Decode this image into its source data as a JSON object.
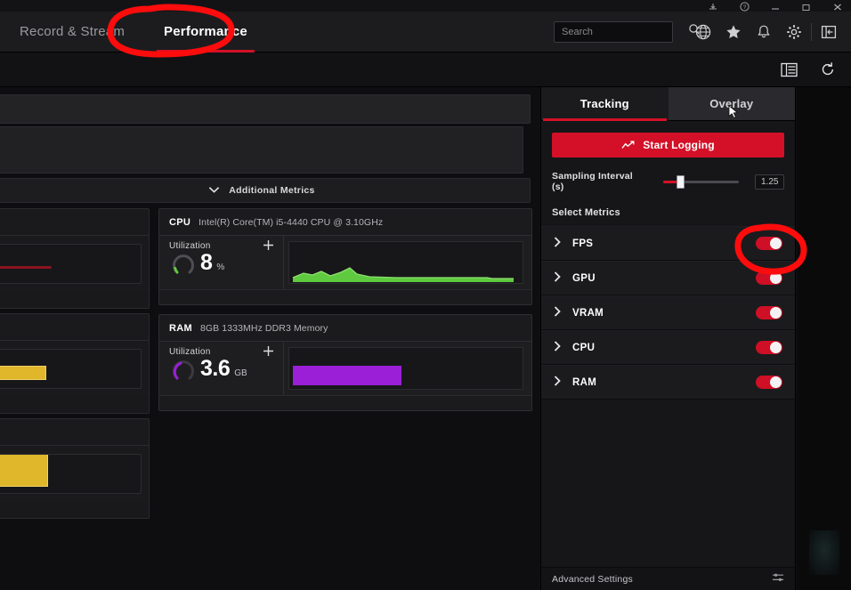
{
  "window": {
    "controls": [
      "minimize-to-tray-icon",
      "help-icon",
      "minimize-icon",
      "restore-icon",
      "close-icon"
    ]
  },
  "nav": {
    "tabs": [
      {
        "label": "Record & Stream",
        "active": false
      },
      {
        "label": "Performance",
        "active": true
      }
    ],
    "search": {
      "placeholder": "Search",
      "value": ""
    },
    "icons": [
      "globe-icon",
      "star-icon",
      "bell-icon",
      "gear-icon",
      "panel-toggle-icon"
    ]
  },
  "subtoolbar": {
    "icons": [
      "list-view-icon",
      "reset-icon"
    ]
  },
  "main": {
    "additional_metrics": {
      "label": "Additional Metrics",
      "icon": "chevron-down-icon"
    },
    "cards": [
      {
        "tag": "CPU",
        "description": "Intel(R) Core(TM) i5-4440 CPU @ 3.10GHz",
        "metric_label": "Utilization",
        "value": "8",
        "unit": "%",
        "graph_color": "#5fc93f",
        "add_icon": "plus-icon"
      },
      {
        "tag": "RAM",
        "description": "8GB 1333MHz DDR3 Memory",
        "metric_label": "Utilization",
        "value": "3.6",
        "unit": "GB",
        "graph_color": "#9b1fd6",
        "add_icon": "plus-icon"
      }
    ]
  },
  "right_panel": {
    "tabs": [
      {
        "label": "Tracking",
        "active": true
      },
      {
        "label": "Overlay",
        "active": false
      }
    ],
    "start_logging": {
      "label": "Start Logging",
      "icon": "trend-line-icon"
    },
    "sampling": {
      "label": "Sampling Interval (s)",
      "value": "1.25"
    },
    "select_metrics_label": "Select Metrics",
    "metrics": [
      {
        "label": "FPS",
        "enabled": true,
        "expand_icon": "chevron-right-icon"
      },
      {
        "label": "GPU",
        "enabled": true,
        "expand_icon": "chevron-right-icon"
      },
      {
        "label": "VRAM",
        "enabled": true,
        "expand_icon": "chevron-right-icon"
      },
      {
        "label": "CPU",
        "enabled": true,
        "expand_icon": "chevron-right-icon"
      },
      {
        "label": "RAM",
        "enabled": true,
        "expand_icon": "chevron-right-icon"
      }
    ],
    "advanced_settings": {
      "label": "Advanced Settings",
      "icon": "sliders-icon"
    }
  },
  "annotations": {
    "color": "#ff0000",
    "marks": [
      {
        "name": "circle-around-performance-tab",
        "shape": "ellipse"
      },
      {
        "name": "circle-around-fps-toggle",
        "shape": "ellipse"
      }
    ]
  },
  "theme": {
    "accent": "#d31027",
    "toggle_on": "#cf0f25",
    "background": "#111113",
    "panel": "#1b1b1e"
  }
}
